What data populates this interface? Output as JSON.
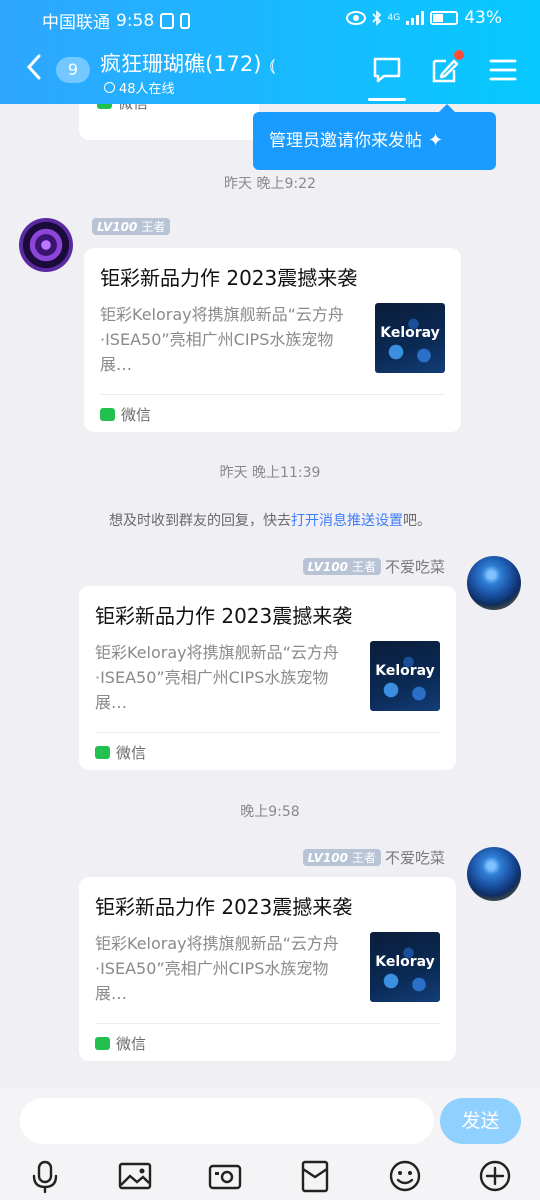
{
  "status_bar": {
    "carrier": "中国联通",
    "time": "9:58",
    "battery": "43%",
    "network": "4G"
  },
  "header": {
    "back_count": "9",
    "title": "疯狂珊瑚礁(172)",
    "ear_icon": "ear-icon",
    "online": "48人在线"
  },
  "tooltip": {
    "text": "管理员邀请你来发帖",
    "sparkle": "✦"
  },
  "chat": {
    "partial_source": "微信",
    "time1": "昨天 晚上9:22",
    "time2": "昨天 晚上11:39",
    "notice_prefix": "想及时收到群友的回复，快去",
    "notice_link": "打开消息推送设置",
    "notice_suffix": "吧。",
    "time3": "晚上9:58",
    "messages": [
      {
        "lv": "LV100",
        "rank": "王者",
        "nickname": "",
        "title": "钜彩新品力作 2023震撼来袭",
        "desc": "钜彩Keloray将携旗舰新品“云方舟·ISEA50”亮相广州CIPS水族宠物展…",
        "thumb_text": "Keloray",
        "source": "微信"
      },
      {
        "lv": "LV100",
        "rank": "王者",
        "nickname": "不爱吃菜",
        "title": "钜彩新品力作 2023震撼来袭",
        "desc": "钜彩Keloray将携旗舰新品“云方舟·ISEA50”亮相广州CIPS水族宠物展…",
        "thumb_text": "Keloray",
        "source": "微信"
      },
      {
        "lv": "LV100",
        "rank": "王者",
        "nickname": "不爱吃菜",
        "title": "钜彩新品力作 2023震撼来袭",
        "desc": "钜彩Keloray将携旗舰新品“云方舟·ISEA50”亮相广州CIPS水族宠物展…",
        "thumb_text": "Keloray",
        "source": "微信"
      }
    ]
  },
  "input_bar": {
    "placeholder": "",
    "send_label": "发送"
  },
  "colors": {
    "header_start": "#2fa6ff",
    "header_end": "#07c9ff",
    "tooltip": "#1a9bff",
    "send": "#8fd0ff",
    "link": "#3f7cff",
    "wechat": "#24c04f"
  }
}
